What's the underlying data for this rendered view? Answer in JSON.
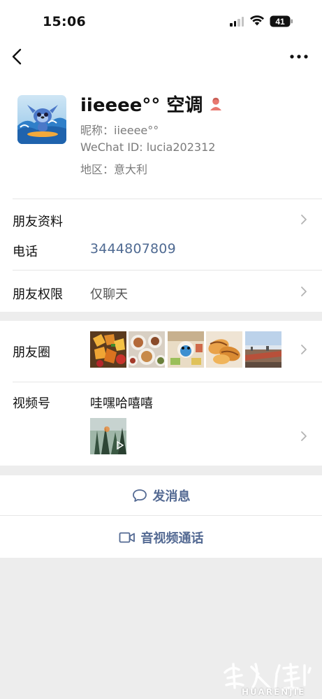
{
  "status_bar": {
    "time": "15:06",
    "battery_level": "41"
  },
  "profile": {
    "display_name": "iieeee°° 空调",
    "nickname_line": "昵称：iieeee°°",
    "wechat_id_line": "WeChat ID: lucia202312",
    "region_line": "地区：意大利",
    "gender": "female"
  },
  "rows": {
    "friend_info_label": "朋友资料",
    "phone_label": "电话",
    "phone_value": "3444807809",
    "permissions_label": "朋友权限",
    "permissions_value": "仅聊天",
    "moments_label": "朋友圈",
    "moments_thumbnails": [
      "food-photo-1",
      "food-photo-2",
      "cartoon-photo",
      "dumplings-photo",
      "rooftop-photo"
    ],
    "channels_label": "视频号",
    "channels_name": "哇嘿哈嘻嘻"
  },
  "actions": {
    "message_label": "发消息",
    "call_label": "音视频通话"
  },
  "colors": {
    "link_blue": "#546a93",
    "phone_blue": "#4f6a92",
    "page_bg": "#ededed",
    "gender_female": "#e8786f"
  },
  "watermark": {
    "text": "HUARENJIE"
  }
}
